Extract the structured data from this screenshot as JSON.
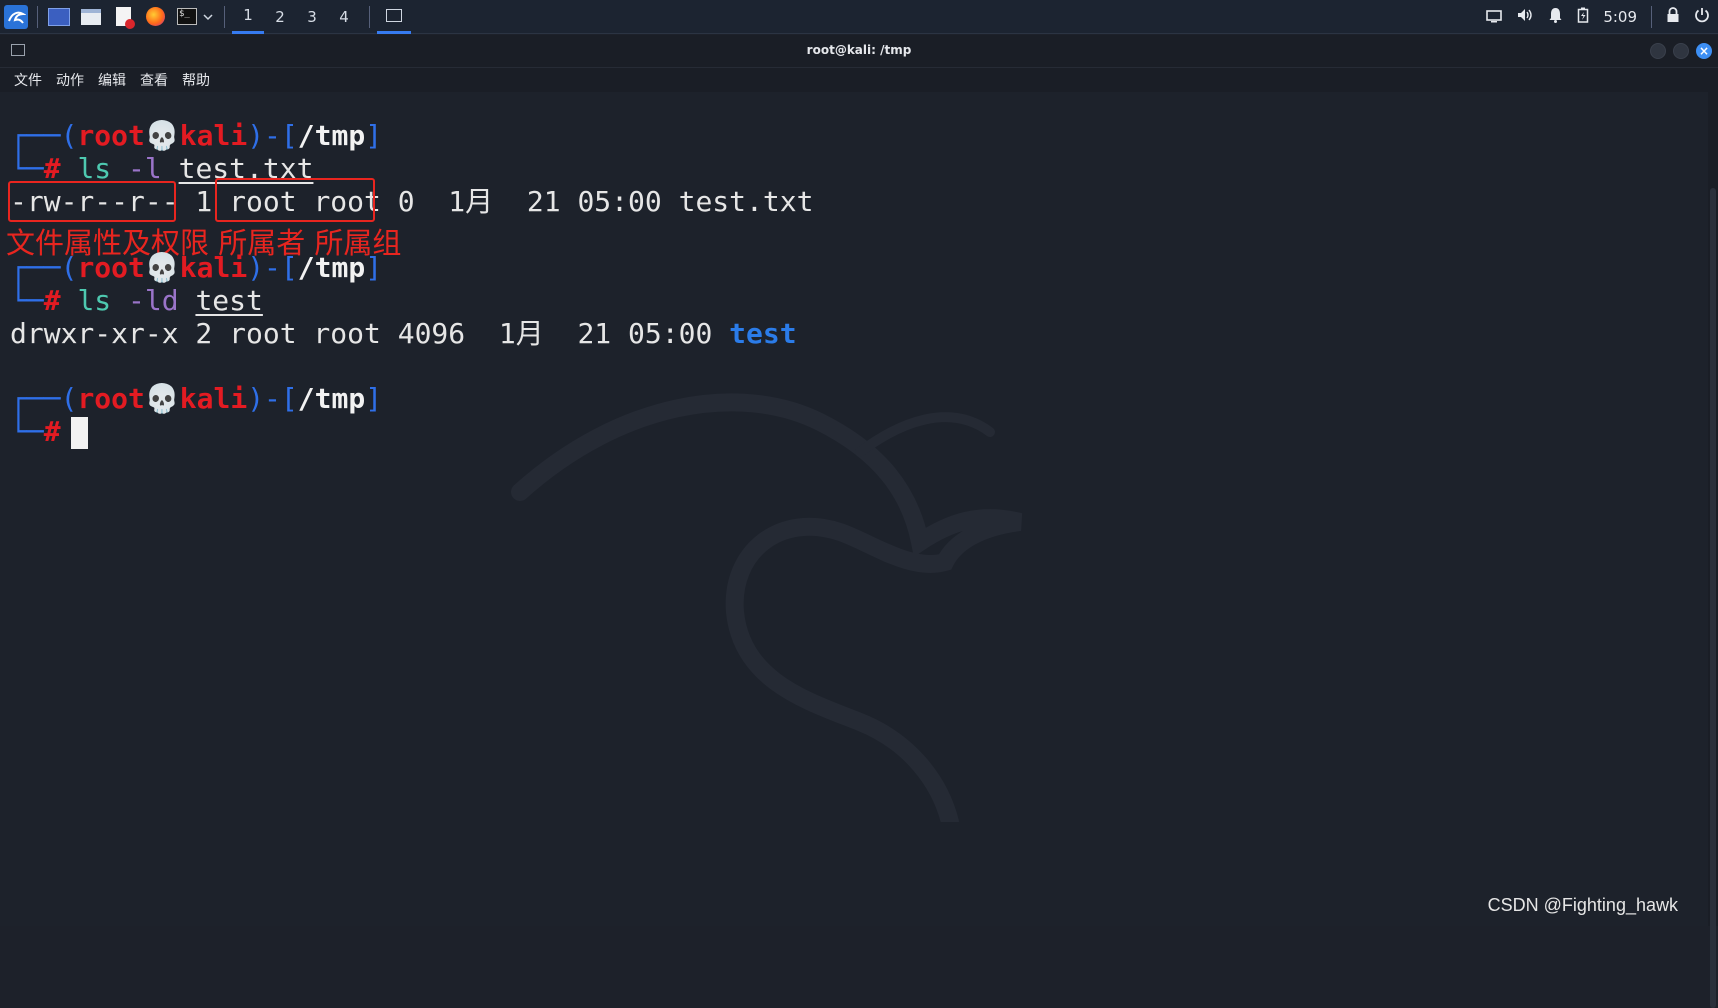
{
  "taskbar": {
    "workspaces": [
      "1",
      "2",
      "3",
      "4"
    ],
    "active_workspace": "1",
    "clock": "5:09",
    "icons": [
      "kali-menu-icon",
      "desktop-icon",
      "file-manager-icon",
      "text-editor-icon",
      "firefox-icon",
      "terminal-icon",
      "terminal-dropdown-icon"
    ],
    "tray_icons": [
      "display-icon",
      "volume-icon",
      "notification-bell-icon",
      "battery-icon",
      "lock-icon",
      "power-icon"
    ]
  },
  "window": {
    "title": "root@kali: /tmp",
    "menu": [
      "文件",
      "动作",
      "编辑",
      "查看",
      "帮助"
    ]
  },
  "terminal": {
    "prompt": {
      "open": "┌──(",
      "user": "root",
      "skull": "💀",
      "host": "kali",
      "mid": ")-[",
      "path": "/tmp",
      "close": "]",
      "second": "└─",
      "hash": "#"
    },
    "cmd1": {
      "cmd": "ls",
      "opt": "-l",
      "arg": "test.txt"
    },
    "out1": {
      "perm": "-rw-r--r--",
      "links": " 1 ",
      "owner": "root root",
      "rest": " 0  1月  21 05:00 test.txt"
    },
    "annotation": "文件属性及权限 所属者 所属组",
    "cmd2": {
      "cmd": "ls",
      "opt": "-ld",
      "arg": "test"
    },
    "out2": {
      "text": "drwxr-xr-x 2 root root 4096  1月  21 05:00 ",
      "dir": "test"
    }
  },
  "watermark": "CSDN @Fighting_hawk",
  "colors": {
    "prompt_frame": "#2f6fe8",
    "prompt_user": "#e31b22",
    "annotation": "#e8251f",
    "directory": "#2b7ce9"
  }
}
